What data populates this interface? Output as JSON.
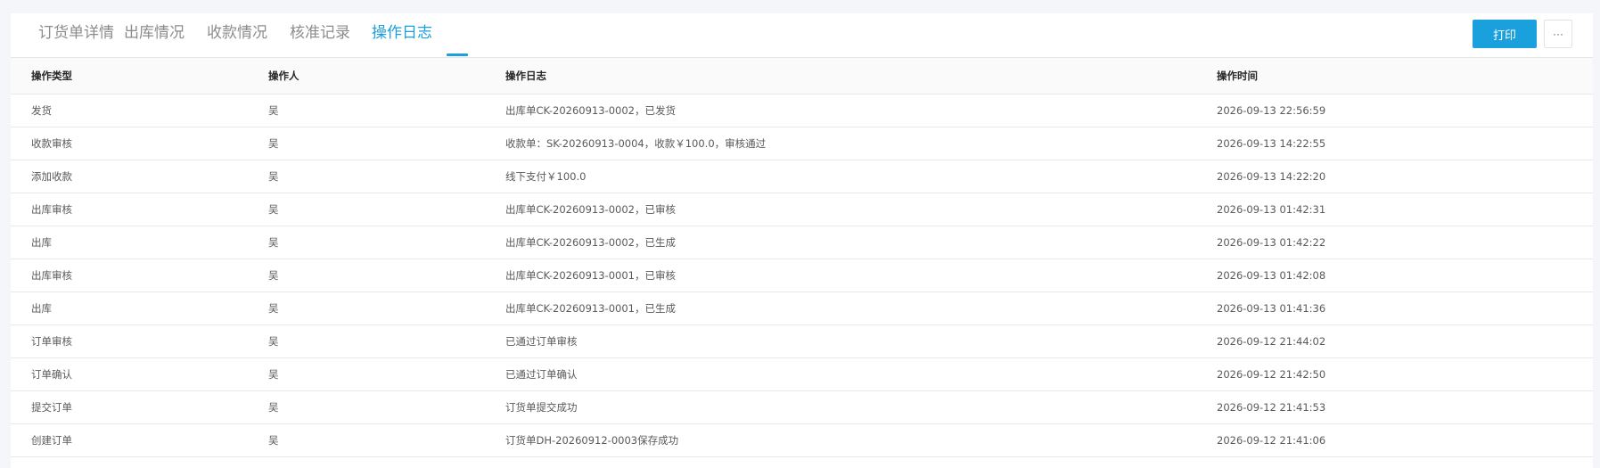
{
  "tabs": [
    {
      "label": "订货单详情",
      "active": false
    },
    {
      "label": "出库情况",
      "active": false
    },
    {
      "label": "收款情况",
      "active": false
    },
    {
      "label": "核准记录",
      "active": false
    },
    {
      "label": "操作日志",
      "active": true
    }
  ],
  "toolbar": {
    "print_label": "打印",
    "more_label": "···"
  },
  "colors": {
    "accent": "#1aa0dc",
    "background": "#f5f6fa"
  },
  "table": {
    "columns": [
      "操作类型",
      "操作人",
      "操作日志",
      "操作时间"
    ],
    "rows": [
      {
        "type": "发货",
        "operator": "吴",
        "log": "出库单CK-20260913-0002，已发货",
        "time": "2026-09-13 22:56:59"
      },
      {
        "type": "收款审核",
        "operator": "吴",
        "log": "收款单：SK-20260913-0004，收款￥100.0，审核通过",
        "time": "2026-09-13 14:22:55"
      },
      {
        "type": "添加收款",
        "operator": "吴",
        "log": "线下支付￥100.0",
        "time": "2026-09-13 14:22:20"
      },
      {
        "type": "出库审核",
        "operator": "吴",
        "log": "出库单CK-20260913-0002，已审核",
        "time": "2026-09-13 01:42:31"
      },
      {
        "type": "出库",
        "operator": "吴",
        "log": "出库单CK-20260913-0002，已生成",
        "time": "2026-09-13 01:42:22"
      },
      {
        "type": "出库审核",
        "operator": "吴",
        "log": "出库单CK-20260913-0001，已审核",
        "time": "2026-09-13 01:42:08"
      },
      {
        "type": "出库",
        "operator": "吴",
        "log": "出库单CK-20260913-0001，已生成",
        "time": "2026-09-13 01:41:36"
      },
      {
        "type": "订单审核",
        "operator": "吴",
        "log": "已通过订单审核",
        "time": "2026-09-12 21:44:02"
      },
      {
        "type": "订单确认",
        "operator": "吴",
        "log": "已通过订单确认",
        "time": "2026-09-12 21:42:50"
      },
      {
        "type": "提交订单",
        "operator": "吴",
        "log": "订货单提交成功",
        "time": "2026-09-12 21:41:53"
      },
      {
        "type": "创建订单",
        "operator": "吴",
        "log": "订货单DH-20260912-0003保存成功",
        "time": "2026-09-12 21:41:06"
      }
    ]
  }
}
